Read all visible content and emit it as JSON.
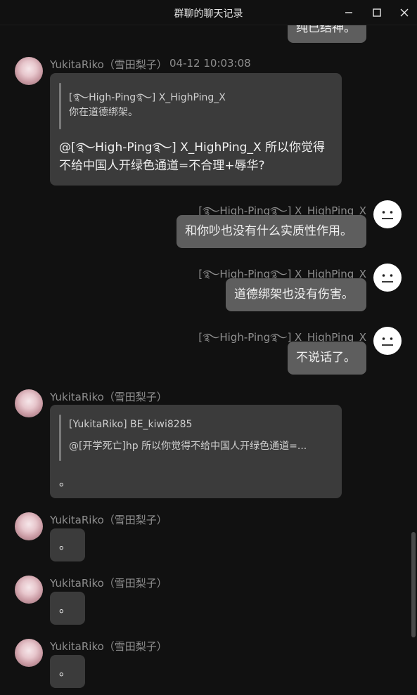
{
  "window": {
    "title": "群聊的聊天记录",
    "controls": [
      "minimize-icon",
      "maximize-icon",
      "close-icon"
    ]
  },
  "colors": {
    "background": "#111111",
    "left_bubble": "#3b3b3b",
    "right_bubble": "#5e5e5e",
    "meta_text": "#8e8e8e"
  },
  "messages": [
    {
      "side": "right",
      "text": "纯已结神。"
    },
    {
      "side": "left",
      "sender": "YukitaRiko（雪田梨子）",
      "time": "04-12 10:03:08",
      "avatar": "anime-avatar",
      "quote": {
        "author": "[࿐High-Ping࿐] X_HighPing_X",
        "text": "你在道德绑架。"
      },
      "text_line1": "@[࿐High-Ping࿐] X_HighPing_X 所以你觉得",
      "text_line2": "不给中国人开绿色通道=不合理+辱华?"
    },
    {
      "side": "right",
      "sender": "[࿐High-Ping࿐] X_HighPing_X",
      "avatar": "neutral-face-icon",
      "text": "和你吵也没有什么实质性作用。"
    },
    {
      "side": "right",
      "sender": "[࿐High-Ping࿐] X_HighPing_X",
      "avatar": "neutral-face-icon",
      "text": "道德绑架也没有伤害。"
    },
    {
      "side": "right",
      "sender": "[࿐High-Ping࿐] X_HighPing_X",
      "avatar": "neutral-face-icon",
      "text": "不说话了。"
    },
    {
      "side": "left",
      "sender": "YukitaRiko（雪田梨子）",
      "avatar": "anime-avatar",
      "quote": {
        "author": "[YukitaRiko] BE_kiwi8285",
        "text": "@[开学死亡]hp 所以你觉得不给中国人开绿色通道=..."
      },
      "text": "。"
    },
    {
      "side": "left",
      "sender": "YukitaRiko（雪田梨子）",
      "avatar": "anime-avatar",
      "text": "。"
    },
    {
      "side": "left",
      "sender": "YukitaRiko（雪田梨子）",
      "avatar": "anime-avatar",
      "text": "。"
    },
    {
      "side": "left",
      "sender": "YukitaRiko（雪田梨子）",
      "avatar": "anime-avatar",
      "text": "。"
    }
  ]
}
